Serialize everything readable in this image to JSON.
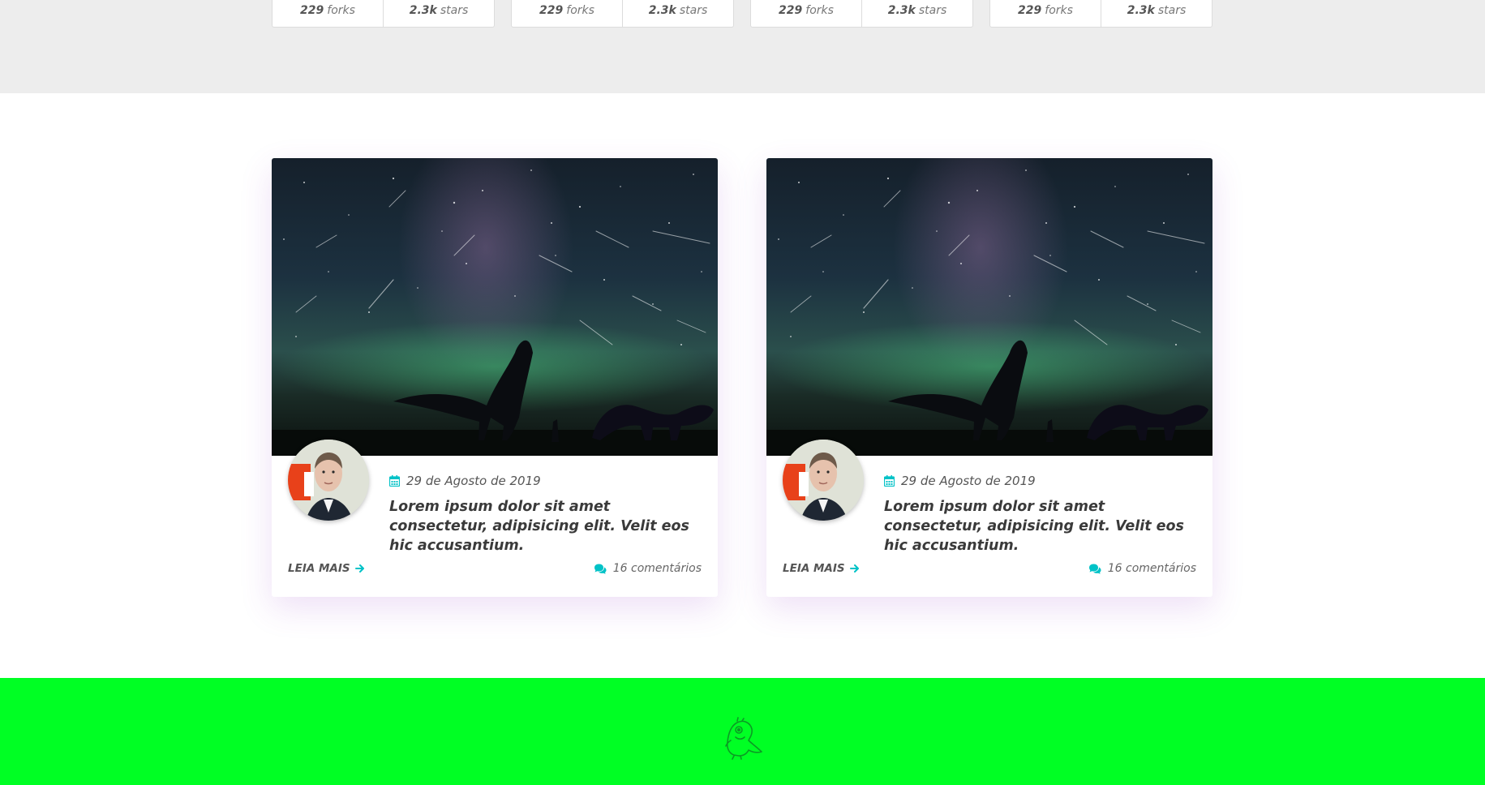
{
  "stats": [
    {
      "forks_value": "229",
      "forks_label": "forks",
      "stars_value": "2.3k",
      "stars_label": "stars"
    },
    {
      "forks_value": "229",
      "forks_label": "forks",
      "stars_value": "2.3k",
      "stars_label": "stars"
    },
    {
      "forks_value": "229",
      "forks_label": "forks",
      "stars_value": "2.3k",
      "stars_label": "stars"
    },
    {
      "forks_value": "229",
      "forks_label": "forks",
      "stars_value": "2.3k",
      "stars_label": "stars"
    }
  ],
  "posts": [
    {
      "date": "29 de Agosto de 2019",
      "title": "Lorem ipsum dolor sit amet consectetur, adipisicing elit. Velit eos hic accusantium.",
      "read_more": "LEIA MAIS",
      "comments": "16 comentários",
      "image_icon": "dinosaur-night-sky-image",
      "avatar_icon": "author-avatar"
    },
    {
      "date": "29 de Agosto de 2019",
      "title": "Lorem ipsum dolor sit amet consectetur, adipisicing elit. Velit eos hic accusantium.",
      "read_more": "LEIA MAIS",
      "comments": "16 comentários",
      "image_icon": "dinosaur-night-sky-image",
      "avatar_icon": "author-avatar"
    }
  ],
  "footer": {
    "mascot_icon": "dinosaur-mascot-icon"
  },
  "colors": {
    "stats_band_bg": "#ededed",
    "accent": "#00c2c7",
    "footer_bg": "#00ff24",
    "text_dark": "#3a3a3a"
  }
}
